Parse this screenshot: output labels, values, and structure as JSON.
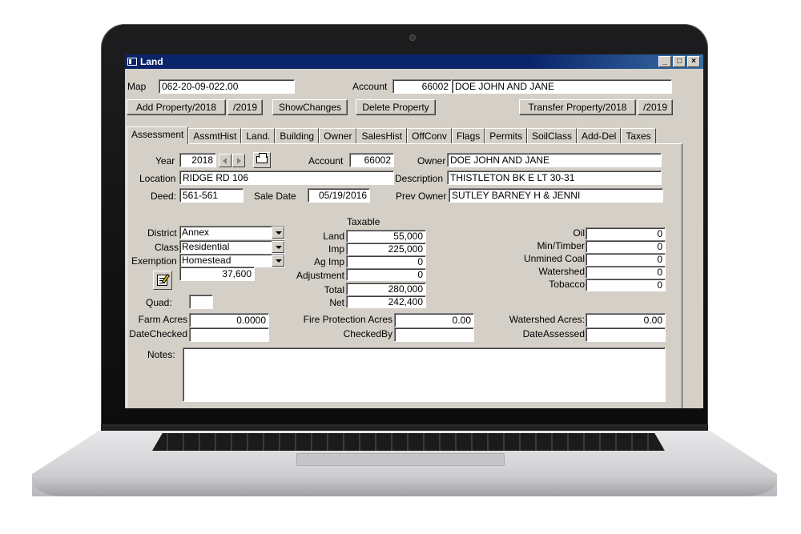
{
  "window": {
    "title": "Land"
  },
  "header": {
    "map_label": "Map",
    "map_value": "062-20-09-022.00",
    "account_label": "Account",
    "account_value": "66002",
    "account_name": "DOE JOHN AND JANE",
    "buttons": {
      "add_property": "Add Property/2018",
      "add_2019": "/2019",
      "show_changes": "ShowChanges",
      "delete_property": "Delete Property",
      "transfer_property": "Transfer Property/2018",
      "transfer_2019": "/2019"
    }
  },
  "tabs": [
    "Assessment",
    "AssmtHist",
    "Land.",
    "Building",
    "Owner",
    "SalesHist",
    "OffConv",
    "Flags",
    "Permits",
    "SoilClass",
    "Add-Del",
    "Taxes"
  ],
  "assessment": {
    "year_label": "Year",
    "year": "2018",
    "account_label": "Account",
    "account": "66002",
    "owner_label": "Owner",
    "owner": "DOE JOHN AND JANE",
    "location_label": "Location",
    "location": "RIDGE RD 106",
    "description_label": "Description",
    "description": "THISTLETON BK E LT 30-31",
    "deed_label": "Deed:",
    "deed": "561-561",
    "sale_date_label": "Sale Date",
    "sale_date": "05/19/2016",
    "prev_owner_label": "Prev Owner",
    "prev_owner": "SUTLEY BARNEY H & JENNI",
    "district_label": "District",
    "district": "Annex",
    "class_label": "Class",
    "class": "Residential",
    "exemption_label": "Exemption",
    "exemption": "Homestead",
    "exemption_amount": "37,600",
    "quad_label": "Quad:",
    "quad": "",
    "taxable_label": "Taxable",
    "land_label": "Land",
    "land": "55,000",
    "imp_label": "Imp",
    "imp": "225,000",
    "ag_imp_label": "Ag Imp",
    "ag_imp": "0",
    "adjustment_label": "Adjustment",
    "adjustment": "0",
    "total_label": "Total",
    "total": "280,000",
    "net_label": "Net",
    "net": "242,400",
    "oil_label": "Oil",
    "oil": "0",
    "min_timber_label": "Min/Timber",
    "min_timber": "0",
    "unmined_coal_label": "Unmined Coal",
    "unmined_coal": "0",
    "watershed_label": "Watershed",
    "watershed": "0",
    "tobacco_label": "Tobacco",
    "tobacco": "0",
    "farm_acres_label": "Farm Acres",
    "farm_acres": "0.0000",
    "fire_protection_label": "Fire Protection Acres",
    "fire_protection": "0.00",
    "watershed_acres_label": "Watershed Acres:",
    "watershed_acres": "0.00",
    "date_checked_label": "DateChecked",
    "date_checked": "",
    "checked_by_label": "CheckedBy",
    "checked_by": "",
    "date_assessed_label": "DateAssessed",
    "date_assessed": "",
    "notes_label": "Notes:",
    "notes": ""
  },
  "colors": {
    "titlebar": "#0a246a",
    "window_bg": "#d4d0c8",
    "field_bg": "#ffffff"
  }
}
